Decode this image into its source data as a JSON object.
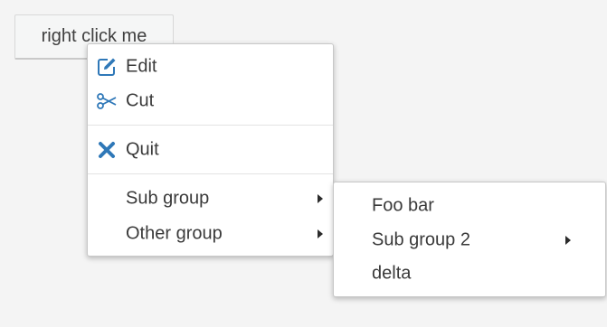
{
  "trigger": {
    "label": "right click me"
  },
  "context_menu": {
    "items": [
      {
        "label": "Edit",
        "icon": "edit-icon"
      },
      {
        "label": "Cut",
        "icon": "scissors-icon"
      },
      {
        "label": "Quit",
        "icon": "close-icon"
      },
      {
        "label": "Sub group",
        "icon": "chevron-right-icon",
        "has_submenu": true
      },
      {
        "label": "Other group",
        "icon": "chevron-right-icon",
        "has_submenu": true
      }
    ]
  },
  "submenu": {
    "items": [
      {
        "label": "Foo bar"
      },
      {
        "label": "Sub group 2",
        "icon": "chevron-right-icon",
        "has_submenu": true
      },
      {
        "label": "delta"
      }
    ]
  },
  "colors": {
    "icon_blue": "#2f78b8",
    "background": "#f4f4f4",
    "menu_background": "#ffffff",
    "text": "#3a3a3a"
  }
}
